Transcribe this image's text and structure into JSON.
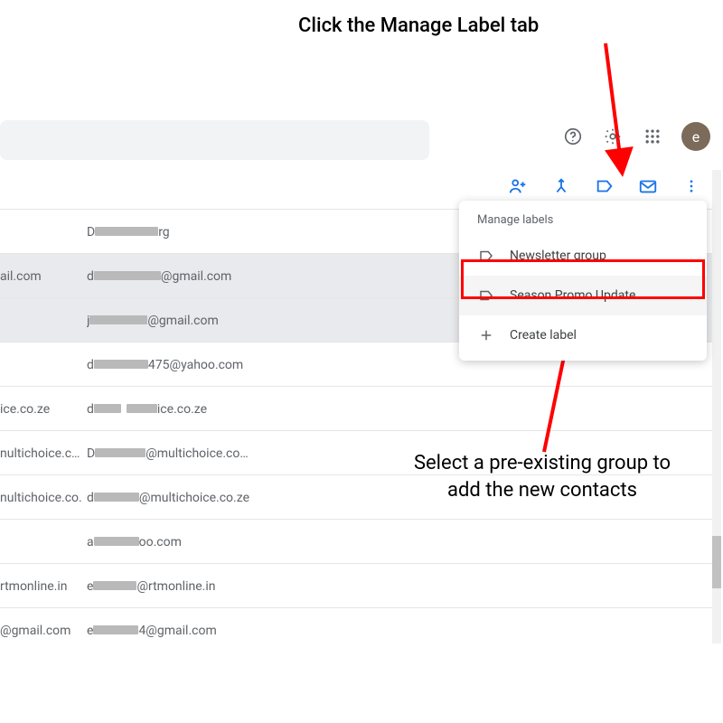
{
  "annotations": {
    "top": "Click the Manage Label tab",
    "bottom": "Select a pre-existing group to add the new contacts"
  },
  "avatar_letter": "e",
  "dropdown": {
    "header": "Manage labels",
    "item_newsletter": "Newsletter group",
    "item_season": "Season Promo Update",
    "item_create": "Create label"
  },
  "rows": {
    "r0": {
      "col1_redactW": 0,
      "col1_tail": "",
      "col2_redactW": 70,
      "col2_tail": "rg",
      "selected": false
    },
    "r1": {
      "col1_redactW": 0,
      "col1_tail": "ail.com",
      "col2_redactW": 74,
      "col2_tail": "@gmail.com",
      "selected": true
    },
    "r2": {
      "col1_redactW": 0,
      "col1_tail": "",
      "col2_redactW": 64,
      "col2_tail": "@gmail.com",
      "selected": true
    },
    "r3": {
      "col1_redactW": 0,
      "col1_tail": "",
      "col2_redactW": 60,
      "col2_tail": "475@yahoo.com",
      "selected": false
    },
    "r4": {
      "col1_redactW": 0,
      "col1_tail": "ice.co.ze",
      "col2_redactW": 45,
      "col2_tail": "ice.co.ze",
      "selected": false,
      "col2_prefix": "d"
    },
    "r5": {
      "col1_redactW": 0,
      "col1_tail": "nultichoice.c…",
      "col2_redactW": 56,
      "col2_tail": "@multichoice.co…",
      "selected": false
    },
    "r6": {
      "col1_redactW": 0,
      "col1_tail": "nultichoice.co…",
      "col2_redactW": 50,
      "col2_tail": "@multichoice.co.ze",
      "selected": false
    },
    "r7": {
      "col1_redactW": 0,
      "col1_tail": "",
      "col2_redactW": 50,
      "col2_tail": "oo.com",
      "selected": false,
      "col2_prefix": "a"
    },
    "r8": {
      "col1_redactW": 0,
      "col1_tail": "rtmonline.in",
      "col2_redactW": 48,
      "col2_tail": "@rtmonline.in",
      "selected": false,
      "col2_prefix": "e"
    },
    "r9": {
      "col1_redactW": 0,
      "col1_tail": "@gmail.com",
      "col2_redactW": 50,
      "col2_tail": "4@gmail.com",
      "selected": false,
      "col2_prefix": "e"
    }
  },
  "colors": {
    "accent": "#1a73e8",
    "annotation_red": "#ff0000"
  }
}
